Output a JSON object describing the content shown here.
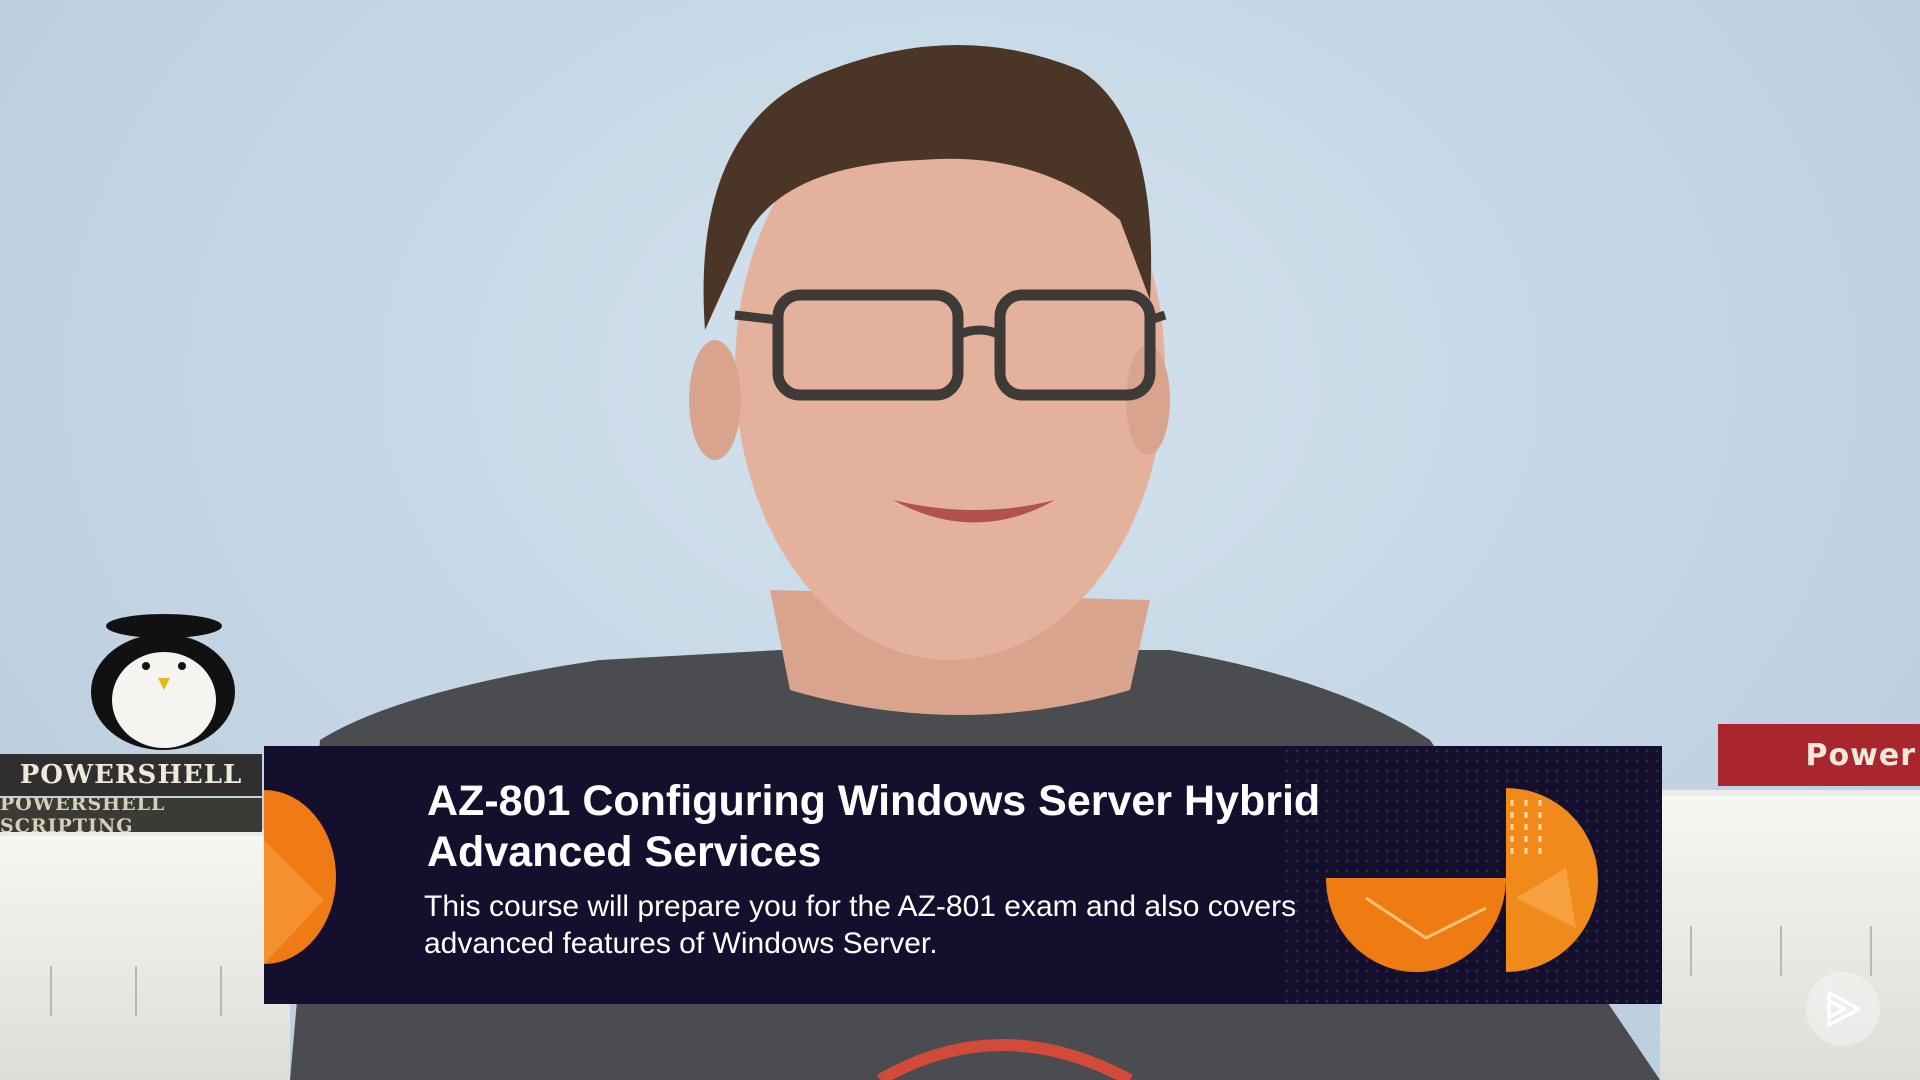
{
  "lower_third": {
    "title": "AZ-801 Configuring Windows Server Hybrid Advanced Services",
    "description": "This course will prepare you for the AZ-801 exam and also covers advanced features of Windows Server."
  },
  "background": {
    "book_top_spine": "POWERSHELL",
    "book_bottom_spine": "POWERSHELL SCRIPTING",
    "book_right_spine": "Power"
  },
  "icons": {
    "watermark": "play-logo-icon",
    "accent": "orange-shape-icon"
  },
  "colors": {
    "banner_background": "#130f2c",
    "accent_orange": "#f07a14",
    "wall": "#c4d6e4"
  }
}
